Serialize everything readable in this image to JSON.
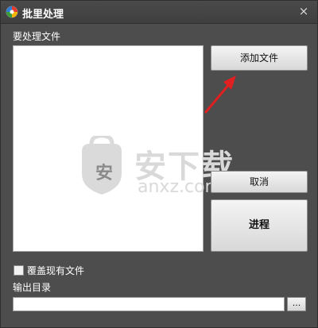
{
  "window": {
    "title": "批里处理",
    "close_symbol": "×"
  },
  "file_section": {
    "label": "要处理文件"
  },
  "buttons": {
    "add_file": "添加文件",
    "cancel": "取消",
    "process": "进程",
    "browse": "..."
  },
  "options": {
    "overwrite_label": "覆盖现有文件",
    "overwrite_checked": false
  },
  "output": {
    "label": "输出目录",
    "value": ""
  },
  "watermark": {
    "cn_text": "安下载",
    "domain": "anxz.com",
    "shield_char": "安"
  },
  "colors": {
    "window_bg": "#4d4d4d",
    "arrow": "#e02020"
  },
  "icons": {
    "app": "app-logo-icon",
    "close": "close-icon",
    "annotation": "red-arrow-icon"
  }
}
